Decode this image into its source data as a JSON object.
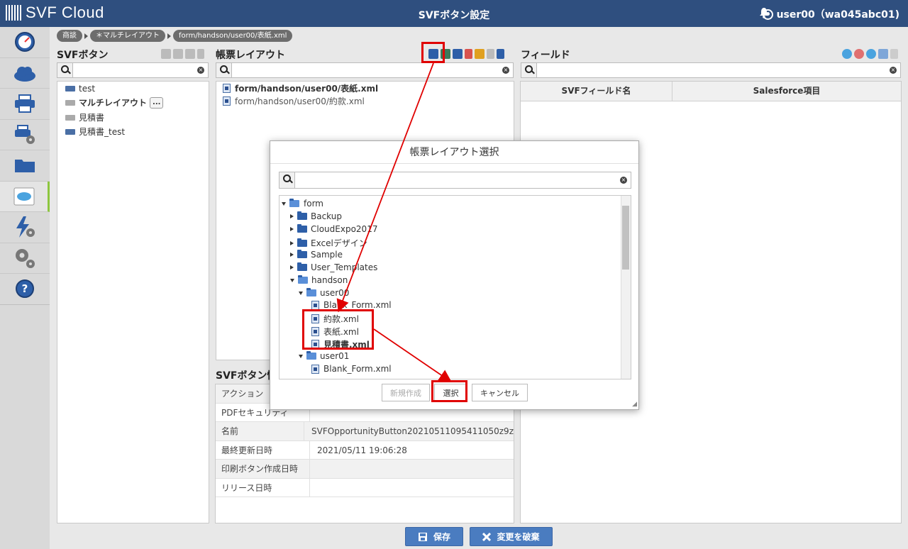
{
  "header": {
    "logo": "SVF Cloud",
    "title": "SVFボタン設定",
    "user": "user00（wa045abc01)"
  },
  "nav": [
    "speedometer-icon",
    "cloud-icon",
    "printer-icon",
    "printer-settings-icon",
    "folder-icon",
    "salesforce-icon",
    "lightning-settings-icon",
    "gears-icon",
    "help-icon"
  ],
  "breadcrumb": [
    "商談",
    "＊マルチレイアウト",
    "form/handson/user00/表紙.xml"
  ],
  "svf_buttons": {
    "title": "SVFボタン",
    "items": [
      {
        "label": "test",
        "bold": false
      },
      {
        "label": "マルチレイアウト",
        "bold": true,
        "more": "..."
      },
      {
        "label": "見積書",
        "bold": false
      },
      {
        "label": "見積書_test",
        "bold": false
      }
    ]
  },
  "layouts": {
    "title": "帳票レイアウト",
    "items": [
      "form/handson/user00/表紙.xml",
      "form/handson/user00/約款.xml"
    ]
  },
  "fields": {
    "title": "フィールド",
    "columns": [
      "SVFフィールド名",
      "Salesforce項目"
    ]
  },
  "info": {
    "title": "SVFボタン情",
    "rows": [
      {
        "k": "アクション",
        "v": ""
      },
      {
        "k": "PDFセキュリティ",
        "v": ""
      },
      {
        "k": "名前",
        "v": "SVFOpportunityButton20210511095411050z9z"
      },
      {
        "k": "最終更新日時",
        "v": "2021/05/11 19:06:28"
      },
      {
        "k": "印刷ボタン作成日時",
        "v": ""
      },
      {
        "k": "リリース日時",
        "v": ""
      }
    ]
  },
  "footer": {
    "save": "保存",
    "discard": "変更を破棄"
  },
  "modal": {
    "title": "帳票レイアウト選択",
    "tree": {
      "root": "form",
      "folders": [
        "Backup",
        "CloudExpo2017",
        "Excelデザイン",
        "Sample",
        "User_Templates",
        "handson"
      ],
      "user00": "user00",
      "files": [
        "Blank_Form.xml",
        "約款.xml",
        "表紙.xml",
        "見積書.xml"
      ],
      "user01": "user01",
      "user01_files": [
        "Blank_Form.xml"
      ]
    },
    "buttons": {
      "new": "新規作成",
      "select": "選択",
      "cancel": "キャンセル"
    }
  }
}
